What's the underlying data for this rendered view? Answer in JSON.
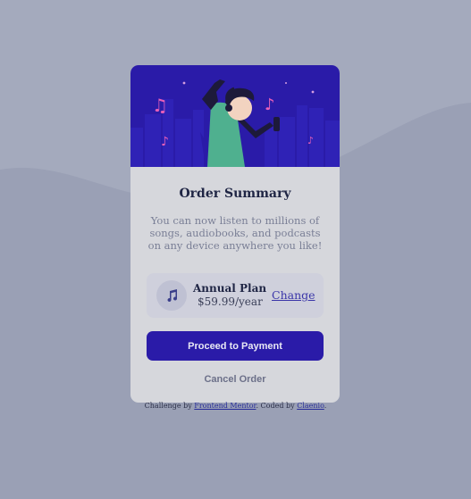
{
  "colors": {
    "page_background": "#9aa0b5",
    "card_background": "#d6d7dc",
    "hero_background": "#2a1ba8",
    "primary_button": "#2a1ba8",
    "heading_text": "#1f2544",
    "body_text": "#7a7f96",
    "link": "#3a35a8"
  },
  "card": {
    "hero_image": "illustration-dancing-person-icon",
    "title": "Order Summary",
    "description": "You can now listen to millions of songs, audiobooks, and podcasts on any device anywhere you like!",
    "plan": {
      "icon": "music-note-icon",
      "name": "Annual Plan",
      "price": "$59.99/year",
      "change_label": "Change"
    },
    "proceed_label": "Proceed to Payment",
    "cancel_label": "Cancel Order"
  },
  "attribution": {
    "prefix": "Challenge by ",
    "mentor_link": "Frontend Mentor",
    "middle": ". Coded by ",
    "author_link": "Claenio",
    "suffix": "."
  }
}
